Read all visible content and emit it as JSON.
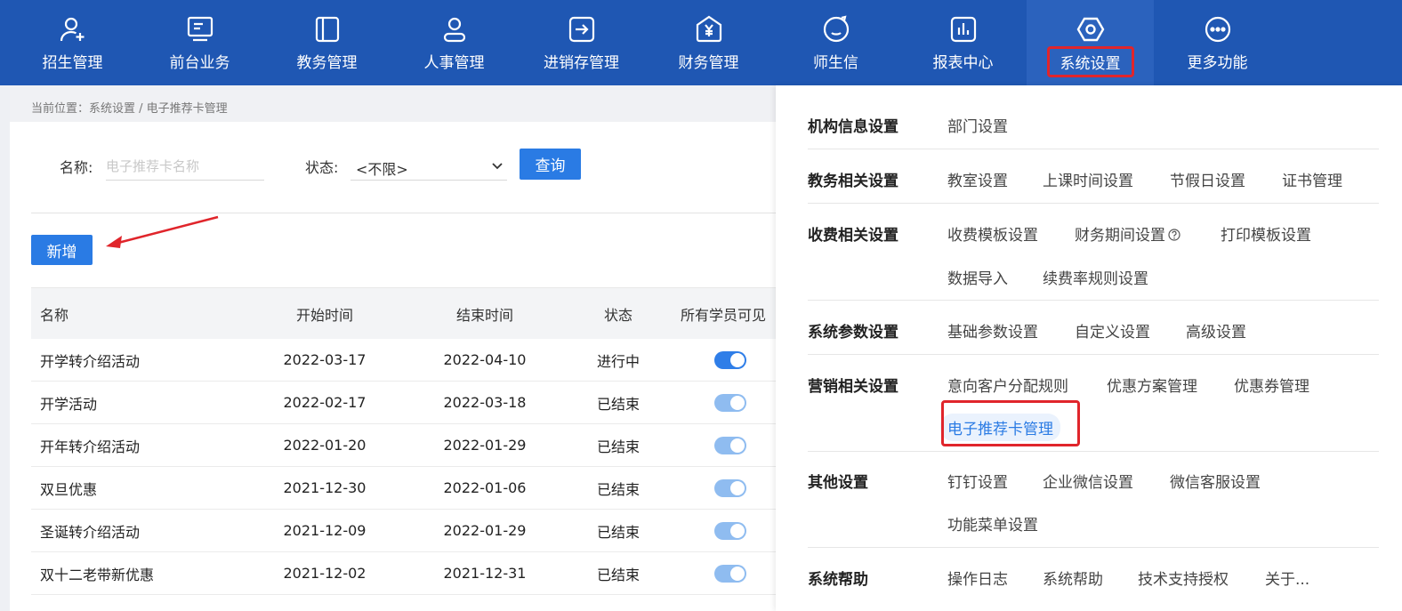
{
  "nav": {
    "items": [
      {
        "label": "招生管理",
        "icon": "add-user-icon"
      },
      {
        "label": "前台业务",
        "icon": "monitor-icon"
      },
      {
        "label": "教务管理",
        "icon": "book-icon"
      },
      {
        "label": "人事管理",
        "icon": "person-icon"
      },
      {
        "label": "进销存管理",
        "icon": "arrow-box-icon"
      },
      {
        "label": "财务管理",
        "icon": "yen-house-icon"
      },
      {
        "label": "师生信",
        "icon": "chat-face-icon"
      },
      {
        "label": "报表中心",
        "icon": "bar-chart-icon"
      },
      {
        "label": "系统设置",
        "icon": "hexagon-gear-icon",
        "active": true
      },
      {
        "label": "更多功能",
        "icon": "more-dots-icon"
      }
    ]
  },
  "breadcrumb": "当前位置：系统设置 / 电子推荐卡管理",
  "filter": {
    "name_label": "名称:",
    "name_placeholder": "电子推荐卡名称",
    "status_label": "状态:",
    "status_value": "<不限>",
    "query_button": "查询"
  },
  "add_button": "新增",
  "table": {
    "headers": [
      "名称",
      "开始时间",
      "结束时间",
      "状态",
      "所有学员可见"
    ],
    "rows": [
      {
        "name": "开学转介绍活动",
        "start": "2022-03-17",
        "end": "2022-04-10",
        "status": "进行中",
        "visible": true
      },
      {
        "name": "开学活动",
        "start": "2022-02-17",
        "end": "2022-03-18",
        "status": "已结束",
        "visible": true
      },
      {
        "name": "开年转介绍活动",
        "start": "2022-01-20",
        "end": "2022-01-29",
        "status": "已结束",
        "visible": true
      },
      {
        "name": "双旦优惠",
        "start": "2021-12-30",
        "end": "2022-01-06",
        "status": "已结束",
        "visible": true
      },
      {
        "name": "圣诞转介绍活动",
        "start": "2021-12-09",
        "end": "2022-01-29",
        "status": "已结束",
        "visible": true
      },
      {
        "name": "双十二老带新优惠",
        "start": "2021-12-02",
        "end": "2021-12-31",
        "status": "已结束",
        "visible": true
      }
    ]
  },
  "menu": {
    "sections": [
      {
        "title": "机构信息设置",
        "items": [
          "部门设置"
        ]
      },
      {
        "title": "教务相关设置",
        "items": [
          "教室设置",
          "上课时间设置",
          "节假日设置",
          "证书管理"
        ]
      },
      {
        "title": "收费相关设置",
        "items": [
          "收费模板设置",
          "财务期间设置",
          "打印模板设置",
          "数据导入",
          "续费率规则设置"
        ]
      },
      {
        "title": "系统参数设置",
        "items": [
          "基础参数设置",
          "自定义设置",
          "高级设置"
        ]
      },
      {
        "title": "营销相关设置",
        "items": [
          "意向客户分配规则",
          "优惠方案管理",
          "优惠券管理",
          "电子推荐卡管理"
        ]
      },
      {
        "title": "其他设置",
        "items": [
          "钉钉设置",
          "企业微信设置",
          "微信客服设置",
          "功能菜单设置"
        ]
      },
      {
        "title": "系统帮助",
        "items": [
          "操作日志",
          "系统帮助",
          "技术支持授权",
          "关于..."
        ]
      }
    ]
  },
  "colors": {
    "nav_bg": "#1f57b3",
    "primary": "#2a7be4",
    "highlight_red": "#e0252b"
  }
}
